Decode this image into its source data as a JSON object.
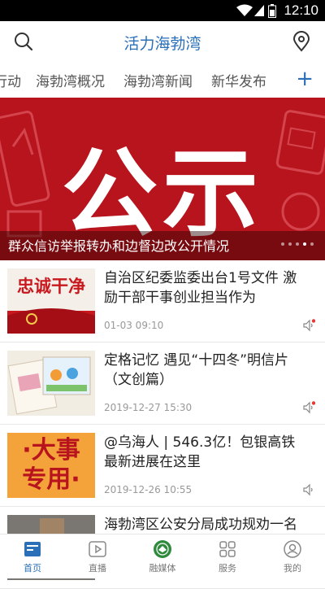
{
  "status_bar": {
    "time": "12:10"
  },
  "header": {
    "title": "活力海勃湾"
  },
  "tabs": [
    {
      "label": "行动"
    },
    {
      "label": "海勃湾概况"
    },
    {
      "label": "海勃湾新闻"
    },
    {
      "label": "新华发布"
    }
  ],
  "tabs_more_label": "+",
  "banner": {
    "big_text": "公示",
    "caption": "群众信访举报转办和边督边改公开情况",
    "slide_count": 5,
    "active_slide": 4
  },
  "news": [
    {
      "title": "自治区纪委监委出台1号文件 激励干部干事创业担当作为",
      "time": "01-03 09:10",
      "thumb_text": "忠诚干净"
    },
    {
      "title": "定格记忆 遇见“十四冬”明信片（文创篇）",
      "time": "2019-12-27 15:30",
      "thumb_text": ""
    },
    {
      "title": "@乌海人 | 546.3亿！包银高铁最新进展在这里",
      "time": "2019-12-26 10:55",
      "thumb_text": "·大事专用·"
    },
    {
      "title": "海勃湾区公安分局成功规劝一名",
      "time": "",
      "thumb_text": ""
    }
  ],
  "bottom_nav": [
    {
      "label": "首页",
      "icon": "home-icon",
      "active": true
    },
    {
      "label": "直播",
      "icon": "live-icon",
      "active": false
    },
    {
      "label": "融媒体",
      "icon": "media-icon",
      "active": false
    },
    {
      "label": "服务",
      "icon": "service-icon",
      "active": false
    },
    {
      "label": "我的",
      "icon": "profile-icon",
      "active": false
    }
  ],
  "colors": {
    "accent": "#2a6fb8",
    "banner_red": "#b8141e",
    "unread_dot": "#e53935"
  }
}
